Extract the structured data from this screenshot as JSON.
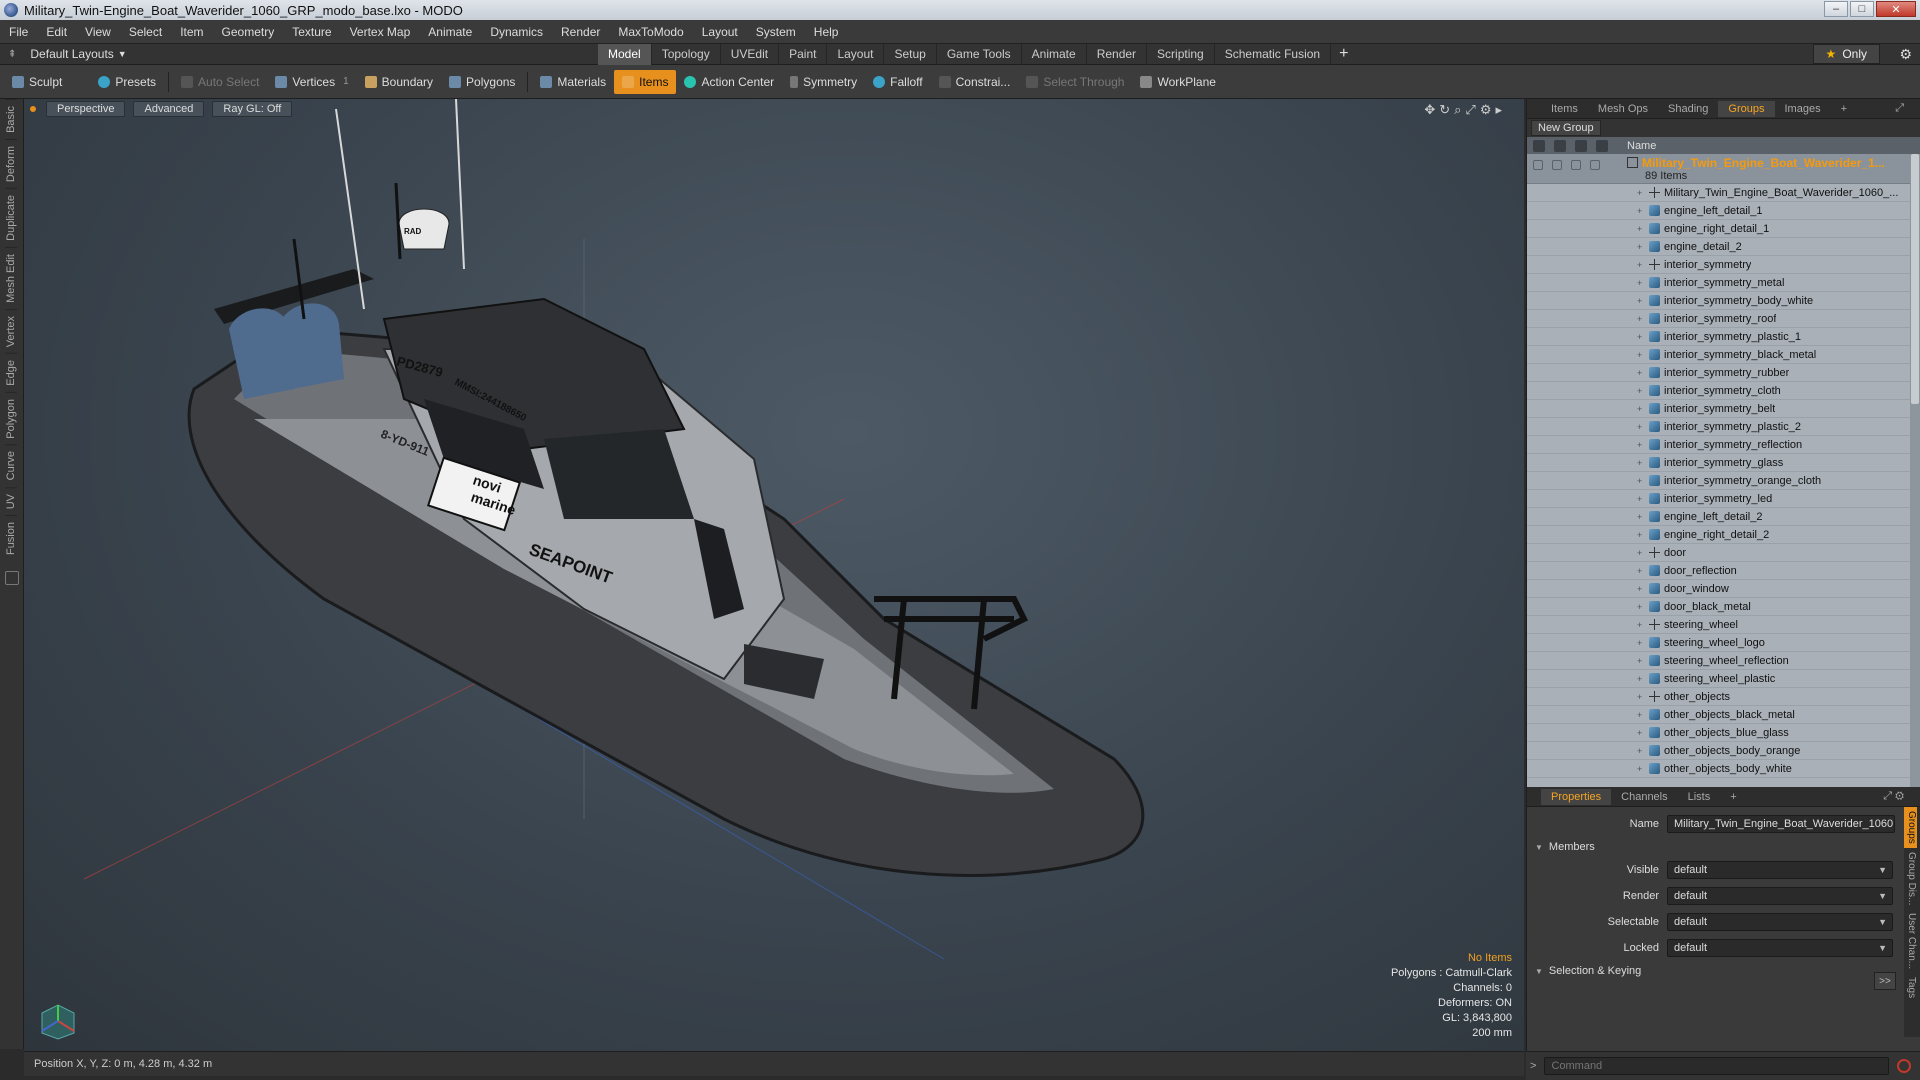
{
  "window": {
    "title": "Military_Twin-Engine_Boat_Waverider_1060_GRP_modo_base.lxo - MODO",
    "minimize": "–",
    "maximize": "□",
    "close": "✕"
  },
  "menu": [
    "File",
    "Edit",
    "View",
    "Select",
    "Item",
    "Geometry",
    "Texture",
    "Vertex Map",
    "Animate",
    "Dynamics",
    "Render",
    "MaxToModo",
    "Layout",
    "System",
    "Help"
  ],
  "layout_bar": {
    "layout_name": "Default Layouts",
    "tabs": [
      "Model",
      "Topology",
      "UVEdit",
      "Paint",
      "Layout",
      "Setup",
      "Game Tools",
      "Animate",
      "Render",
      "Scripting",
      "Schematic Fusion"
    ],
    "active_tab": "Model",
    "only_label": "Only"
  },
  "toolbar": {
    "sculpt": "Sculpt",
    "presets": "Presets",
    "auto_select": "Auto Select",
    "vertices": "Vertices",
    "vertices_count": "1",
    "boundary": "Boundary",
    "polygons": "Polygons",
    "materials": "Materials",
    "items": "Items",
    "action_center": "Action Center",
    "symmetry": "Symmetry",
    "falloff": "Falloff",
    "constraints": "Constrai...",
    "select_through": "Select Through",
    "workplane": "WorkPlane"
  },
  "left_tabs": [
    "Basic",
    "Deform",
    "Duplicate",
    "Mesh Edit",
    "Vertex",
    "Edge",
    "Polygon",
    "Curve",
    "UV",
    "Fusion"
  ],
  "viewport": {
    "view_mode": "Perspective",
    "shading": "Advanced",
    "raygl": "Ray GL: Off",
    "boat_labels": {
      "hull_id": "PD2879",
      "mmsi": "MMSI:244188650",
      "reg": "8-YD-911",
      "logo_line1": "novi",
      "logo_line2": "marine",
      "brand": "SEAPOINT",
      "radar": "RAD"
    },
    "info": {
      "selection": "No Items",
      "polygons": "Polygons : Catmull-Clark",
      "channels": "Channels: 0",
      "deformers": "Deformers: ON",
      "gl": "GL: 3,843,800",
      "scale": "200 mm"
    }
  },
  "status": {
    "position": "Position X, Y, Z:  0 m, 4.28 m, 4.32 m"
  },
  "right_panel": {
    "top_tabs": [
      "Items",
      "Mesh Ops",
      "Shading",
      "Groups",
      "Images"
    ],
    "active_top_tab": "Groups",
    "new_group": "New Group",
    "name_header": "Name",
    "group_name": "Military_Twin_Engine_Boat_Waverider_1...",
    "group_count": "89 Items",
    "items": [
      {
        "name": "Military_Twin_Engine_Boat_Waverider_1060_...",
        "icon": "locator"
      },
      {
        "name": "engine_left_detail_1",
        "icon": "mesh"
      },
      {
        "name": "engine_right_detail_1",
        "icon": "mesh"
      },
      {
        "name": "engine_detail_2",
        "icon": "mesh"
      },
      {
        "name": "interior_symmetry",
        "icon": "locator"
      },
      {
        "name": "interior_symmetry_metal",
        "icon": "mesh"
      },
      {
        "name": "interior_symmetry_body_white",
        "icon": "mesh"
      },
      {
        "name": "interior_symmetry_roof",
        "icon": "mesh"
      },
      {
        "name": "interior_symmetry_plastic_1",
        "icon": "mesh"
      },
      {
        "name": "interior_symmetry_black_metal",
        "icon": "mesh"
      },
      {
        "name": "interior_symmetry_rubber",
        "icon": "mesh"
      },
      {
        "name": "interior_symmetry_cloth",
        "icon": "mesh"
      },
      {
        "name": "interior_symmetry_belt",
        "icon": "mesh"
      },
      {
        "name": "interior_symmetry_plastic_2",
        "icon": "mesh"
      },
      {
        "name": "interior_symmetry_reflection",
        "icon": "mesh"
      },
      {
        "name": "interior_symmetry_glass",
        "icon": "mesh"
      },
      {
        "name": "interior_symmetry_orange_cloth",
        "icon": "mesh"
      },
      {
        "name": "interior_symmetry_led",
        "icon": "mesh"
      },
      {
        "name": "engine_left_detail_2",
        "icon": "mesh"
      },
      {
        "name": "engine_right_detail_2",
        "icon": "mesh"
      },
      {
        "name": "door",
        "icon": "locator"
      },
      {
        "name": "door_reflection",
        "icon": "mesh"
      },
      {
        "name": "door_window",
        "icon": "mesh"
      },
      {
        "name": "door_black_metal",
        "icon": "mesh"
      },
      {
        "name": "steering_wheel",
        "icon": "locator"
      },
      {
        "name": "steering_wheel_logo",
        "icon": "mesh"
      },
      {
        "name": "steering_wheel_reflection",
        "icon": "mesh"
      },
      {
        "name": "steering_wheel_plastic",
        "icon": "mesh"
      },
      {
        "name": "other_objects",
        "icon": "locator"
      },
      {
        "name": "other_objects_black_metal",
        "icon": "mesh"
      },
      {
        "name": "other_objects_blue_glass",
        "icon": "mesh"
      },
      {
        "name": "other_objects_body_orange",
        "icon": "mesh"
      },
      {
        "name": "other_objects_body_white",
        "icon": "mesh"
      }
    ],
    "prop_tabs": [
      "Properties",
      "Channels",
      "Lists"
    ],
    "active_prop_tab": "Properties",
    "props": {
      "name_label": "Name",
      "name_value": "Military_Twin_Engine_Boat_Waverider_1060",
      "members_label": "Members",
      "visible_label": "Visible",
      "visible_value": "default",
      "render_label": "Render",
      "render_value": "default",
      "selectable_label": "Selectable",
      "selectable_value": "default",
      "locked_label": "Locked",
      "locked_value": "default",
      "selection_keying": "Selection & Keying",
      "expand": ">>"
    },
    "side_tabs": [
      "Groups",
      "Group Dis...",
      "User Chan...",
      "Tags"
    ],
    "command_placeholder": "Command"
  },
  "colors": {
    "accent": "#e8901d",
    "group_name": "#f59a0c"
  }
}
